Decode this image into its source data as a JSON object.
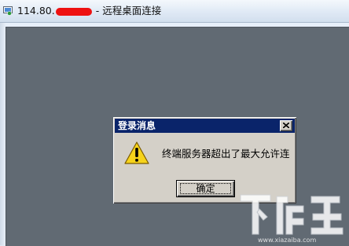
{
  "window": {
    "title_prefix": "114.80.",
    "title_suffix": "- 远程桌面连接"
  },
  "dialog": {
    "title": "登录消息",
    "message": "终端服务器超出了最大允许连",
    "ok_label": "确定",
    "close_glyph": "×"
  },
  "watermark": {
    "logo_text": "下载吧",
    "site_text": "www.xiazaiba.com"
  },
  "colors": {
    "desktop": "#616a73",
    "dialog_face": "#d4d0c8",
    "dialog_titlebar": "#0a246a",
    "redaction": "#ee1111",
    "warning": "#f6d31b"
  },
  "icons": [
    "remote-desktop-app-icon",
    "close-icon",
    "warning-icon"
  ]
}
